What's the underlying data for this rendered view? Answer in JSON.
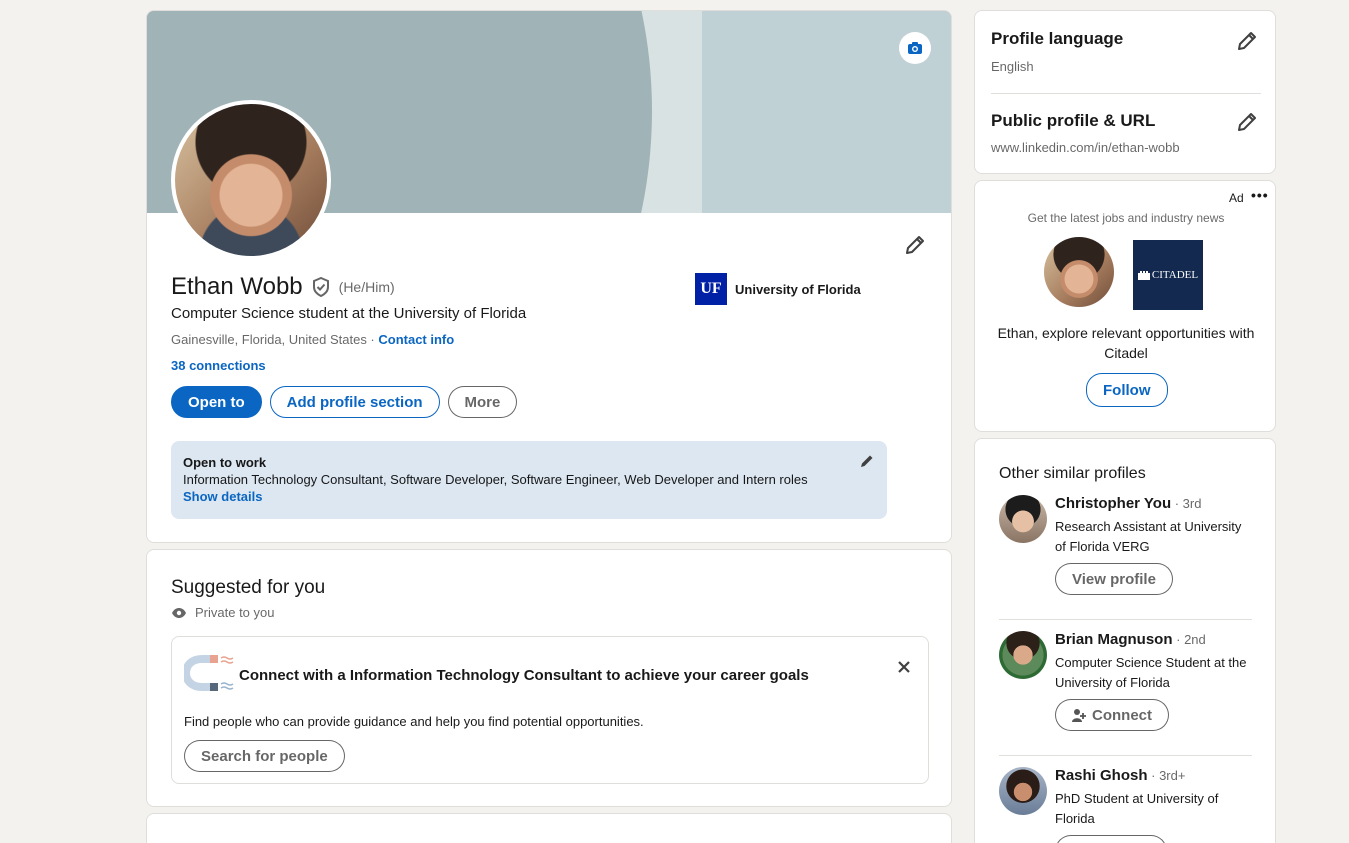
{
  "profile": {
    "name": "Ethan Wobb",
    "pronouns": "(He/Him)",
    "headline": "Computer Science student at the University of Florida",
    "location": "Gainesville, Florida, United States",
    "location_separator": " · ",
    "contact_info": "Contact info",
    "connections": "38 connections",
    "school": "University of Florida",
    "school_logo_text": "UF",
    "buttons": {
      "open_to": "Open to",
      "add_section": "Add profile section",
      "more": "More"
    },
    "open_to_work": {
      "title": "Open to work",
      "roles": "Information Technology Consultant, Software Developer, Software Engineer, Web Developer and Intern roles",
      "details": "Show details"
    }
  },
  "suggested": {
    "title": "Suggested for you",
    "privacy": "Private to you",
    "headline": "Connect with a Information Technology Consultant to achieve your career goals",
    "description": "Find people who can provide guidance and help you find potential opportunities.",
    "button": "Search for people"
  },
  "sidebar": {
    "profile_language": {
      "title": "Profile language",
      "value": "English"
    },
    "public_profile": {
      "title": "Public profile & URL",
      "value": "www.linkedin.com/in/ethan-wobb"
    },
    "ad": {
      "label": "Ad",
      "more": "•••",
      "tagline": "Get the latest jobs and industry news",
      "logo_text": "CITADEL",
      "text": "Ethan, explore relevant opportunities with Citadel",
      "button": "Follow"
    },
    "similar": {
      "title": "Other similar profiles",
      "people": [
        {
          "name": "Christopher You",
          "degree": " · 3rd",
          "headline": "Research Assistant at University of Florida VERG",
          "button": "View profile"
        },
        {
          "name": "Brian Magnuson",
          "degree": " · 2nd",
          "headline": "Computer Science Student at the University of Florida",
          "button": "Connect"
        },
        {
          "name": "Rashi Ghosh",
          "degree": " · 3rd+",
          "headline": "PhD Student at University of Florida",
          "button": ""
        }
      ]
    }
  },
  "colors": {
    "brand": "#0a66c2",
    "page_bg": "#f4f2ee",
    "banner": "#a0b4b7",
    "open_to_work_bg": "#dde7f1",
    "uf_blue": "#0021a5",
    "citadel_navy": "#14294f"
  }
}
